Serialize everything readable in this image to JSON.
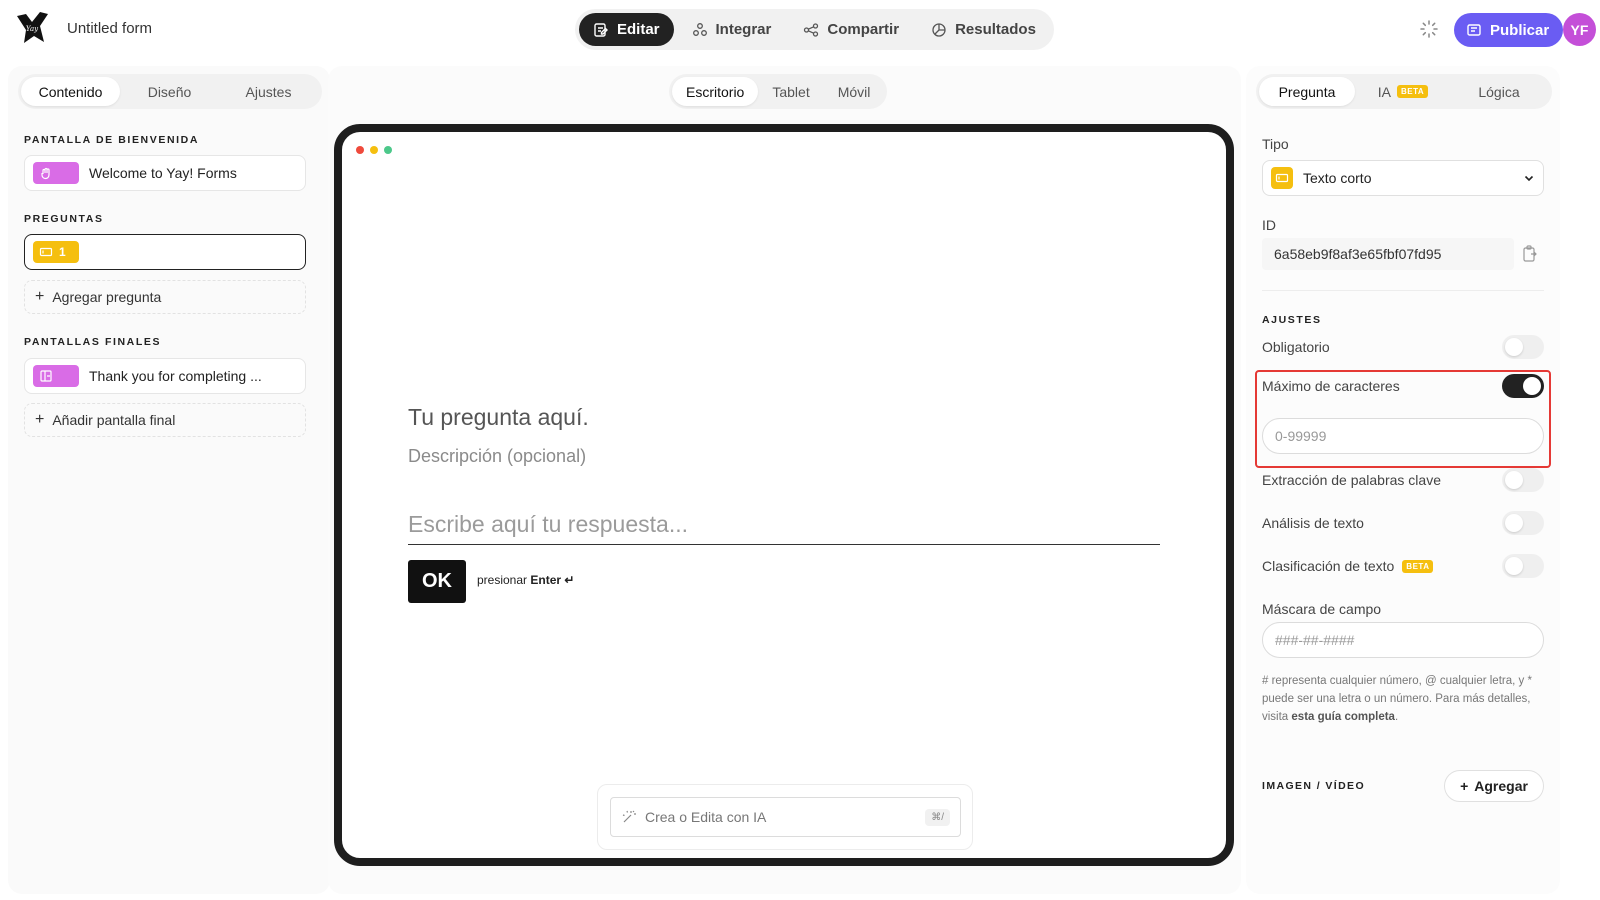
{
  "app": {
    "form_title": "Untitled form",
    "avatar_initials": "YF"
  },
  "mode_tabs": [
    {
      "label": "Editar",
      "icon": "edit-icon",
      "active": true
    },
    {
      "label": "Integrar",
      "icon": "integrate-icon",
      "active": false
    },
    {
      "label": "Compartir",
      "icon": "share-icon",
      "active": false
    },
    {
      "label": "Resultados",
      "icon": "results-icon",
      "active": false
    }
  ],
  "publish": {
    "label": "Publicar"
  },
  "left": {
    "tabs": [
      "Contenido",
      "Diseño",
      "Ajustes"
    ],
    "welcome_title": "PANTALLA DE BIENVENIDA",
    "welcome_item": "Welcome to Yay! Forms",
    "questions_title": "PREGUNTAS",
    "question_number": "1",
    "add_question": "Agregar pregunta",
    "endings_title": "PANTALLAS FINALES",
    "ending_item": "Thank you for completing ...",
    "add_ending": "Añadir pantalla final"
  },
  "center": {
    "device_tabs": [
      "Escritorio",
      "Tablet",
      "Móvil"
    ],
    "question_title": "Tu pregunta aquí.",
    "question_description": "Descripción (opcional)",
    "answer_placeholder": "Escribe aquí tu respuesta...",
    "ok_label": "OK",
    "enter_hint_prefix": "presionar",
    "enter_hint_key": "Enter ↵",
    "ai_placeholder": "Crea o Edita con IA",
    "ai_shortcut": "⌘/"
  },
  "right": {
    "tabs": [
      "Pregunta",
      "IA",
      "Lógica"
    ],
    "beta_label": "BETA",
    "type_label": "Tipo",
    "type_value": "Texto corto",
    "id_label": "ID",
    "id_value": "6a58eb9f8af3e65fbf07fd95",
    "settings_title": "AJUSTES",
    "toggles": [
      {
        "label": "Obligatorio",
        "on": false
      },
      {
        "label": "Máximo de caracteres",
        "on": true
      },
      {
        "label": "Extracción de palabras clave",
        "on": false
      },
      {
        "label": "Análisis de texto",
        "on": false
      },
      {
        "label": "Clasificación de texto",
        "on": false,
        "beta": true
      }
    ],
    "max_chars_placeholder": "0-99999",
    "mask_label": "Máscara de campo",
    "mask_placeholder": "###-##-####",
    "help_text_prefix": "# representa cualquier número, @ cualquier letra, y * puede ser una letra o un número. Para más detalles, visita",
    "help_text_link": "esta guía completa",
    "help_text_suffix": ".",
    "media_title": "IMAGEN / VÍDEO",
    "add_media": "Agregar"
  },
  "colors": {
    "accent": "#6a5cf3",
    "avatar": "#c44fd8",
    "welcome_badge": "#d96ce6",
    "question_badge": "#f5bf0f",
    "highlight": "#e53935",
    "dot_red": "#ef4a3c",
    "dot_yellow": "#f5bf0f",
    "dot_green": "#4cc88a"
  }
}
